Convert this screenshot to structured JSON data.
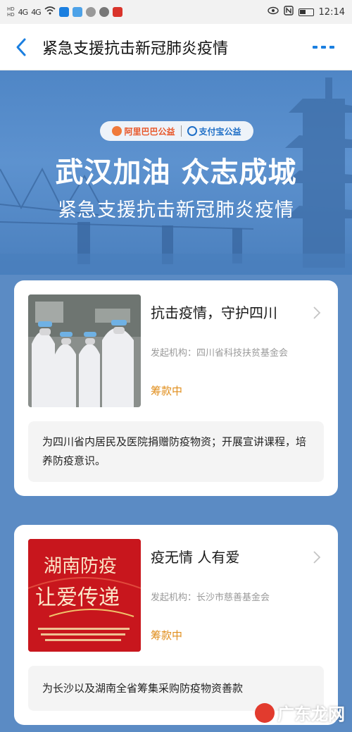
{
  "status_bar": {
    "time": "12:14",
    "signal_a": "4G",
    "signal_b": "4G",
    "hd": "HD"
  },
  "nav": {
    "title": "紧急支援抗击新冠肺炎疫情"
  },
  "banner": {
    "logo_left": "阿里巴巴公益",
    "logo_right": "支付宝公益",
    "headline": "武汉加油  众志成城",
    "subline": "紧急支援抗击新冠肺炎疫情"
  },
  "projects": [
    {
      "title": "抗击疫情，守护四川",
      "org": "发起机构：四川省科技扶贫基金会",
      "status": "筹款中",
      "desc": "为四川省内居民及医院捐赠防疫物资；开展宣讲课程，培养防疫意识。"
    },
    {
      "title": "疫无情 人有爱",
      "org": "发起机构：长沙市慈善基金会",
      "status": "筹款中",
      "desc": "为长沙以及湖南全省筹集采购防疫物资善款",
      "image_text_1": "湖南防疫",
      "image_text_2": "让爱传递"
    }
  ],
  "watermark": "广东龙网",
  "colors": {
    "accent": "#1b7fe0",
    "status": "#e08d1a",
    "banner": "#5b8bc4"
  }
}
